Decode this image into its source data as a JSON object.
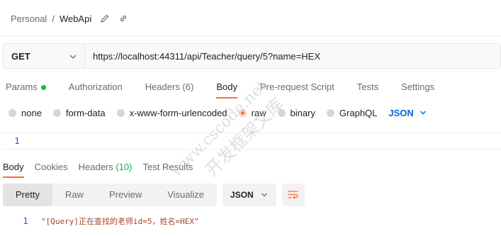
{
  "breadcrumb": {
    "parent": "Personal",
    "separator": "/",
    "current": "WebApi"
  },
  "request": {
    "method": "GET",
    "url": "https://localhost:44311/api/Teacher/query/5?name=HEX"
  },
  "tabs": [
    {
      "label": "Params",
      "active": false
    },
    {
      "label": "Authorization",
      "active": false
    },
    {
      "label": "Headers (6)",
      "active": false
    },
    {
      "label": "Body",
      "active": true
    },
    {
      "label": "Pre-request Script",
      "active": false
    },
    {
      "label": "Tests",
      "active": false
    },
    {
      "label": "Settings",
      "active": false
    }
  ],
  "body_types": [
    {
      "label": "none",
      "selected": false
    },
    {
      "label": "form-data",
      "selected": false
    },
    {
      "label": "x-www-form-urlencoded",
      "selected": false
    },
    {
      "label": "raw",
      "selected": true
    },
    {
      "label": "binary",
      "selected": false
    },
    {
      "label": "GraphQL",
      "selected": false
    }
  ],
  "body_format": "JSON",
  "editor": {
    "line_number": "1"
  },
  "response_tabs": [
    {
      "label": "Body",
      "count": ""
    },
    {
      "label": "Cookies",
      "count": ""
    },
    {
      "label": "Headers",
      "count": "(10)"
    },
    {
      "label": "Test Results",
      "count": ""
    }
  ],
  "response_views": [
    "Pretty",
    "Raw",
    "Preview",
    "Visualize"
  ],
  "response_format": "JSON",
  "response": {
    "line_number": "1",
    "text": "\"[Query]正在查找的老师id=5，姓名=HEX\""
  },
  "watermark": {
    "line1": "www.cscode.net",
    "line2": "开发框架文库"
  },
  "colors": {
    "accent": "#ff6c37",
    "link": "#0265d2",
    "success": "#0cbb52"
  }
}
